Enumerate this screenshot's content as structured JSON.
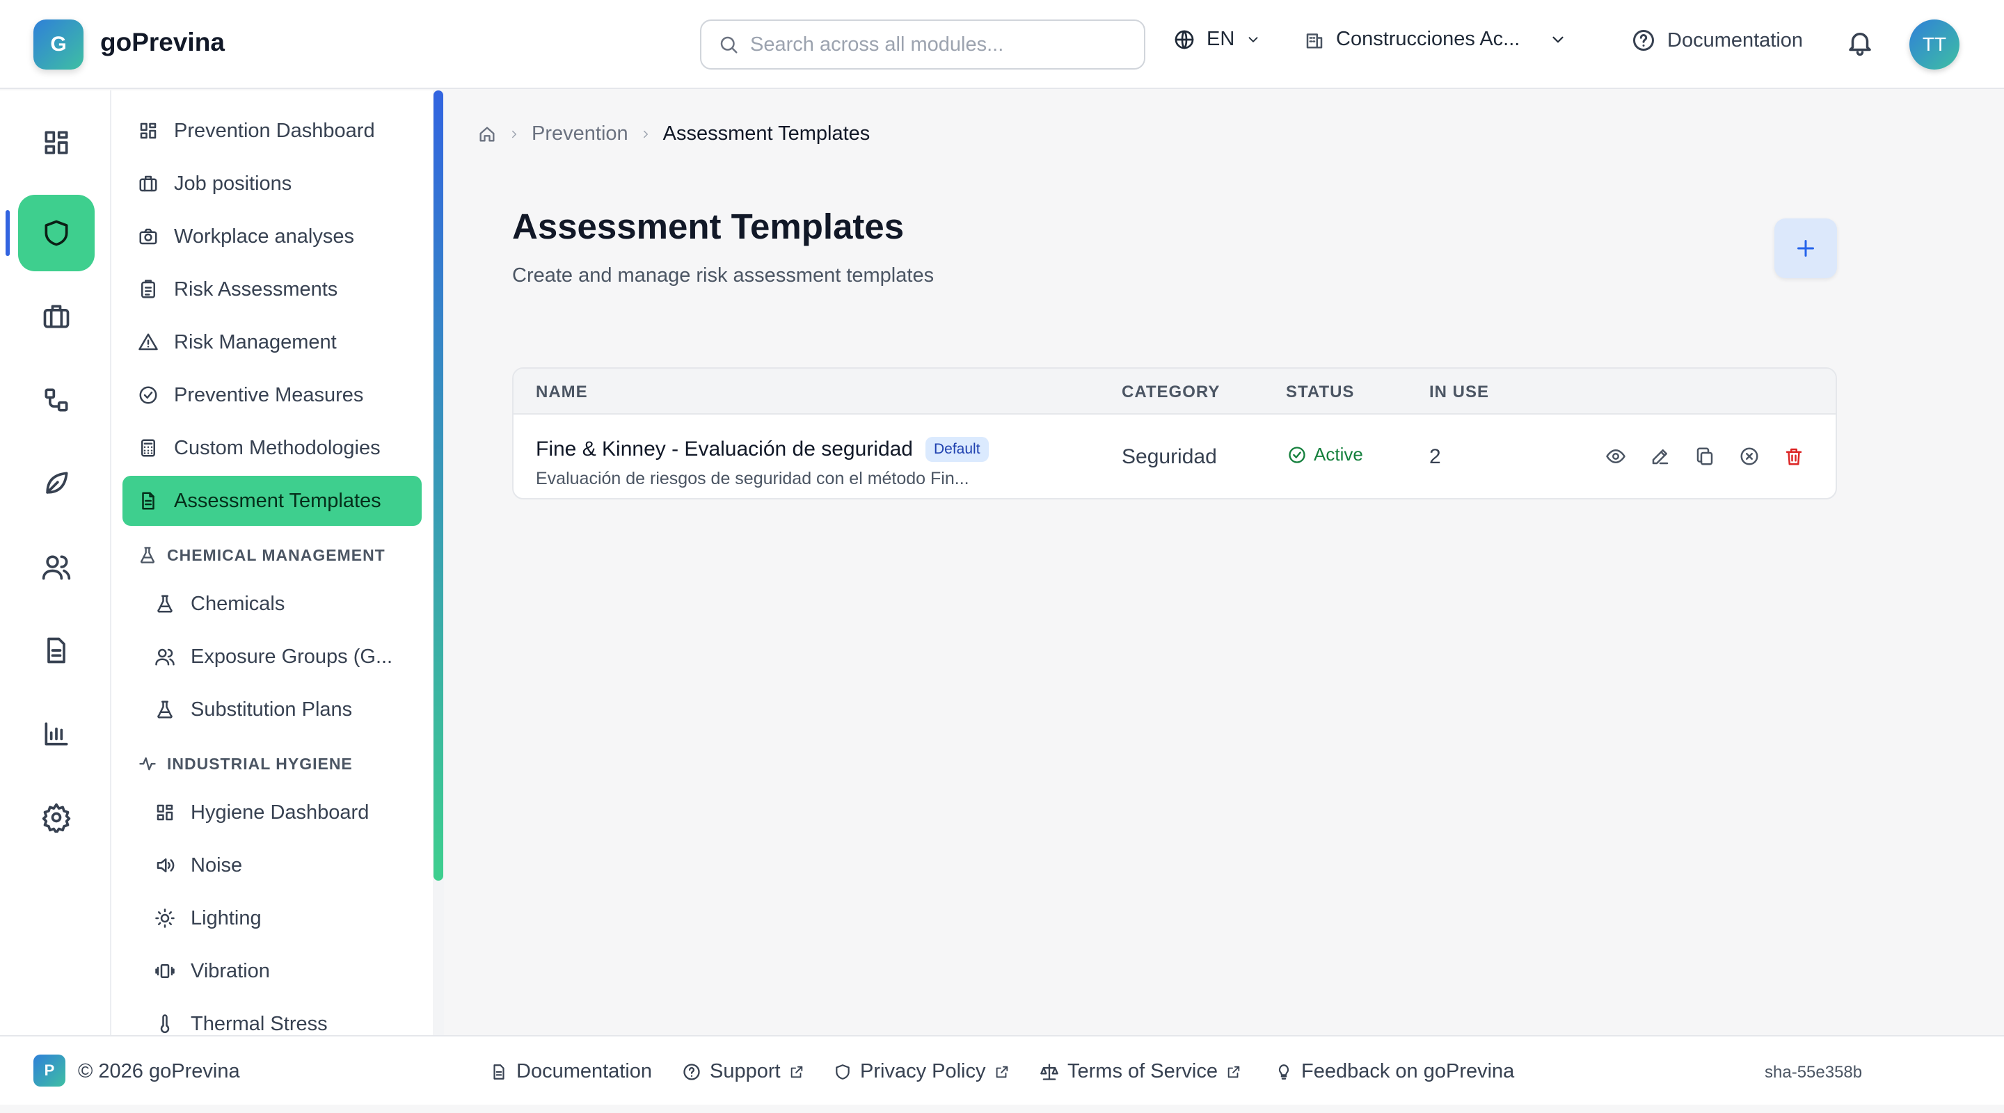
{
  "app": {
    "logo_letter": "G",
    "name": "goPrevina",
    "avatar": "TT"
  },
  "header": {
    "search_placeholder": "Search across all modules...",
    "language": "EN",
    "company": "Construcciones Ac...",
    "docs": "Documentation"
  },
  "rail": [
    "dashboard-icon",
    "shield-icon",
    "briefcase-icon",
    "workflow-icon",
    "leaf-icon",
    "users-icon",
    "document-icon",
    "bar-chart-icon",
    "settings-icon"
  ],
  "nav": {
    "items": [
      {
        "label": "Prevention Dashboard",
        "icon": "dashboard-icon"
      },
      {
        "label": "Job positions",
        "icon": "briefcase-icon"
      },
      {
        "label": "Workplace analyses",
        "icon": "camera-icon"
      },
      {
        "label": "Risk Assessments",
        "icon": "clipboard-icon"
      },
      {
        "label": "Risk Management",
        "icon": "warning-icon"
      },
      {
        "label": "Preventive Measures",
        "icon": "check-circle-icon"
      },
      {
        "label": "Custom Methodologies",
        "icon": "calculator-icon"
      },
      {
        "label": "Assessment Templates",
        "icon": "file-text-icon"
      }
    ],
    "chemical": {
      "title": "CHEMICAL MANAGEMENT",
      "items": [
        "Chemicals",
        "Exposure Groups (G...",
        "Substitution Plans"
      ]
    },
    "hygiene": {
      "title": "INDUSTRIAL HYGIENE",
      "items": [
        "Hygiene Dashboard",
        "Noise",
        "Lighting",
        "Vibration",
        "Thermal Stress"
      ]
    }
  },
  "breadcrumb": {
    "parent": "Prevention",
    "current": "Assessment Templates"
  },
  "page": {
    "title": "Assessment Templates",
    "subtitle": "Create and manage risk assessment templates"
  },
  "table": {
    "headers": {
      "name": "NAME",
      "category": "CATEGORY",
      "status": "STATUS",
      "in_use": "IN USE"
    },
    "rows": [
      {
        "name": "Fine & Kinney - Evaluación de seguridad",
        "badge": "Default",
        "description": "Evaluación de riesgos de seguridad con el método Fin...",
        "category": "Seguridad",
        "status": "Active",
        "in_use": "2"
      }
    ]
  },
  "footer": {
    "logo_letter": "P",
    "copyright": "© 2026 goPrevina",
    "links": [
      "Documentation",
      "Support",
      "Privacy Policy",
      "Terms of Service",
      "Feedback on goPrevina"
    ],
    "sha": "sha-55e358b"
  },
  "colors": {
    "accent": "#3ecf8e",
    "primary": "#3264e0",
    "danger": "#dc2626",
    "success": "#15803d"
  }
}
